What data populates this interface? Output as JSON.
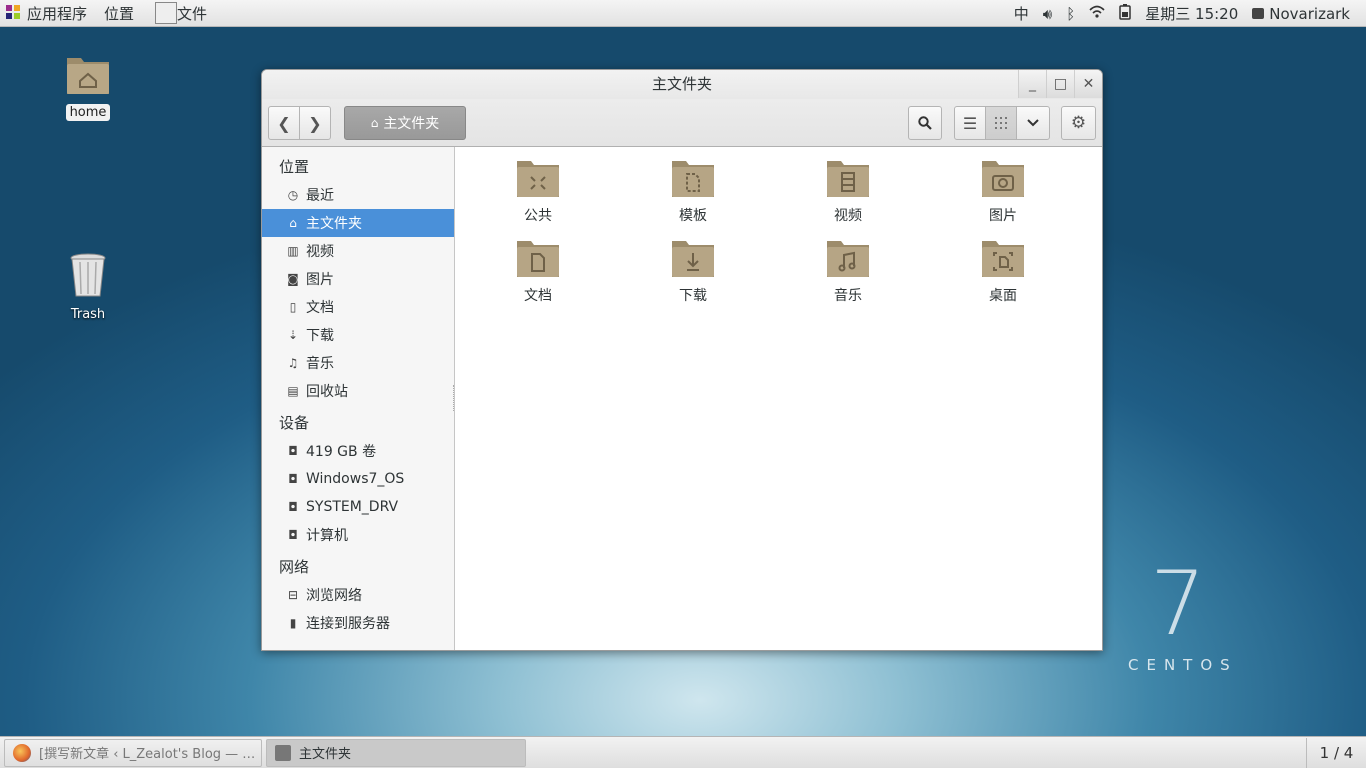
{
  "top_panel": {
    "apps_label": "应用程序",
    "places_label": "位置",
    "files_label": "文件",
    "input_method": "中",
    "clock": "星期三 15:20",
    "user": "Novarizark"
  },
  "desktop": {
    "home_label": "home",
    "trash_label": "Trash",
    "watermark_number": "7",
    "watermark_word": "CENTOS"
  },
  "window": {
    "title": "主文件夹",
    "breadcrumb": "主文件夹"
  },
  "sidebar": {
    "places_heading": "位置",
    "places": [
      {
        "label": "最近",
        "icon": "clock-icon"
      },
      {
        "label": "主文件夹",
        "icon": "home-icon"
      },
      {
        "label": "视频",
        "icon": "film-icon"
      },
      {
        "label": "图片",
        "icon": "camera-icon"
      },
      {
        "label": "文档",
        "icon": "document-icon"
      },
      {
        "label": "下载",
        "icon": "download-icon"
      },
      {
        "label": "音乐",
        "icon": "music-icon"
      },
      {
        "label": "回收站",
        "icon": "trash-icon"
      }
    ],
    "devices_heading": "设备",
    "devices": [
      {
        "label": "419 GB 卷",
        "icon": "drive-icon"
      },
      {
        "label": "Windows7_OS",
        "icon": "drive-icon"
      },
      {
        "label": "SYSTEM_DRV",
        "icon": "drive-icon"
      },
      {
        "label": "计算机",
        "icon": "drive-icon"
      }
    ],
    "network_heading": "网络",
    "network": [
      {
        "label": "浏览网络",
        "icon": "network-icon"
      },
      {
        "label": "连接到服务器",
        "icon": "server-icon"
      }
    ]
  },
  "folders": [
    {
      "label": "公共",
      "icon": "share-icon"
    },
    {
      "label": "模板",
      "icon": "template-icon"
    },
    {
      "label": "视频",
      "icon": "film-icon"
    },
    {
      "label": "图片",
      "icon": "camera-icon"
    },
    {
      "label": "文档",
      "icon": "document-icon"
    },
    {
      "label": "下载",
      "icon": "download-icon"
    },
    {
      "label": "音乐",
      "icon": "music-icon"
    },
    {
      "label": "桌面",
      "icon": "desktop-icon"
    }
  ],
  "taskbar": {
    "task1": "[撰写新文章 ‹ L_Zealot's Blog — …",
    "task2": "主文件夹",
    "pager": "1 / 4"
  },
  "colors": {
    "selection": "#4a90d9",
    "folder": "#b6a585"
  }
}
